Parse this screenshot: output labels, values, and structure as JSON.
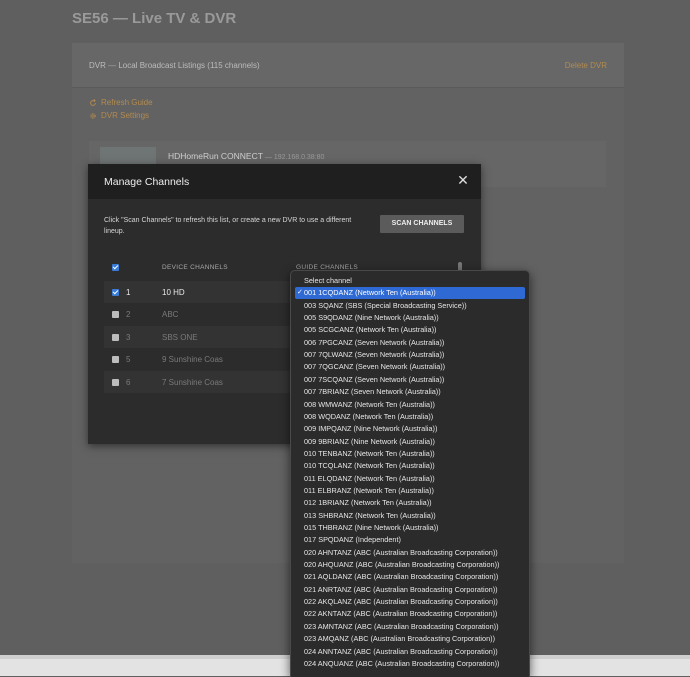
{
  "page": {
    "title": "SE56 — Live TV & DVR"
  },
  "dvr": {
    "header_label": "DVR",
    "header_sep": " — ",
    "header_detail": "Local Broadcast Listings (115 channels)",
    "delete_label": "Delete DVR",
    "actions": [
      {
        "label": "Refresh Guide",
        "icon": "refresh-icon"
      },
      {
        "label": "DVR Settings",
        "icon": "gear-icon"
      }
    ],
    "device": {
      "name": "HDHomeRun CONNECT",
      "sep": " — ",
      "ip": "192.168.0.38:80"
    }
  },
  "modal": {
    "title": "Manage Channels",
    "description": "Click \"Scan Channels\" to refresh this list, or create a new DVR to use a different lineup.",
    "scan_button": "SCAN CHANNELS",
    "col_device": "DEVICE CHANNELS",
    "col_guide": "GUIDE CHANNELS",
    "header_checked": true,
    "rows": [
      {
        "num": "1",
        "name": "10 HD",
        "checked": true
      },
      {
        "num": "2",
        "name": "ABC",
        "checked": false
      },
      {
        "num": "3",
        "name": "SBS ONE",
        "checked": false
      },
      {
        "num": "5",
        "name": "9 Sunshine Coas",
        "checked": false
      },
      {
        "num": "6",
        "name": "7 Sunshine Coas",
        "checked": false
      }
    ]
  },
  "dropdown": {
    "selected_index": 1,
    "options": [
      "Select channel",
      "001 1CQDANZ (Network Ten (Australia))",
      "003 SQANZ (SBS (Special Broadcasting Service))",
      "005 S9QDANZ (Nine Network (Australia))",
      "005 SCGCANZ (Network Ten (Australia))",
      "006 7PGCANZ (Seven Network (Australia))",
      "007 7QLWANZ (Seven Network (Australia))",
      "007 7QGCANZ (Seven Network (Australia))",
      "007 7SCQANZ (Seven Network (Australia))",
      "007 7BRIANZ (Seven Network (Australia))",
      "008 WMWANZ (Network Ten (Australia))",
      "008 WQDANZ (Network Ten (Australia))",
      "009 IMPQANZ (Nine Network (Australia))",
      "009 9BRIANZ (Nine Network (Australia))",
      "010 TENBANZ (Network Ten (Australia))",
      "010 TCQLANZ (Network Ten (Australia))",
      "011 ELQDANZ (Network Ten (Australia))",
      "011 ELBRANZ (Network Ten (Australia))",
      "012 1BRIANZ (Network Ten (Australia))",
      "013 SHBRANZ (Network Ten (Australia))",
      "015 THBRANZ (Nine Network (Australia))",
      "017 SPQDANZ (Independent)",
      "020 AHNTANZ (ABC (Australian Broadcasting Corporation))",
      "020 AHQUANZ (ABC (Australian Broadcasting Corporation))",
      "021 AQLDANZ (ABC (Australian Broadcasting Corporation))",
      "021 ANRTANZ (ABC (Australian Broadcasting Corporation))",
      "022 AKQLANZ (ABC (Australian Broadcasting Corporation))",
      "022 AKNTANZ (ABC (Australian Broadcasting Corporation))",
      "023 AMNTANZ (ABC (Australian Broadcasting Corporation))",
      "023 AMQANZ (ABC (Australian Broadcasting Corporation))",
      "024 ANNTANZ (ABC (Australian Broadcasting Corporation))",
      "024 ANQUANZ (ABC (Australian Broadcasting Corporation))"
    ]
  },
  "colors": {
    "accent": "#b38b4f",
    "selected": "#2f6ad4",
    "checkbox_on": "#3a7bd5"
  }
}
